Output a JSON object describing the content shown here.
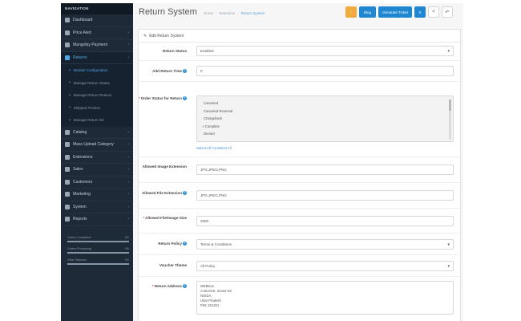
{
  "sidebar": {
    "header": "NAVIGATION",
    "items": [
      {
        "label": "Dashboard",
        "icon": "dashboard-icon",
        "chevron": false
      },
      {
        "label": "Price Alert",
        "icon": "tag-icon",
        "chevron": true
      },
      {
        "label": "Mangofay Payment",
        "icon": "card-icon",
        "chevron": true
      },
      {
        "label": "Returns",
        "icon": "return-icon",
        "chevron": true,
        "active": true
      }
    ],
    "subitems": [
      {
        "label": "Module Configuration",
        "current": true
      },
      {
        "label": "Manage Return Status"
      },
      {
        "label": "Manage Return Reason"
      },
      {
        "label": "Shipped Product"
      },
      {
        "label": "Manage Return list"
      }
    ],
    "items2": [
      {
        "label": "Catalog",
        "icon": "catalog-icon",
        "chevron": true
      },
      {
        "label": "Mass Upload Category",
        "icon": "upload-icon",
        "chevron": true
      },
      {
        "label": "Extensions",
        "icon": "puzzle-icon",
        "chevron": true
      },
      {
        "label": "Sales",
        "icon": "cart-icon",
        "chevron": true
      },
      {
        "label": "Customers",
        "icon": "user-icon",
        "chevron": true
      },
      {
        "label": "Marketing",
        "icon": "share-icon",
        "chevron": true
      },
      {
        "label": "System",
        "icon": "gear-icon",
        "chevron": true
      },
      {
        "label": "Reports",
        "icon": "chart-icon",
        "chevron": true
      }
    ],
    "stats": [
      {
        "label": "Orders Completed",
        "value": "0%",
        "fill": 1.0
      },
      {
        "label": "Orders Processing",
        "value": "0%",
        "fill": 1.0
      },
      {
        "label": "Other Statuses",
        "value": "0%",
        "fill": 1.0
      }
    ]
  },
  "header": {
    "title": "Return System",
    "breadcrumbs": [
      "Home",
      "Extension",
      "Return System"
    ],
    "buttons": {
      "flag": "!",
      "blog": "Blog",
      "generate": "Generate Ticket",
      "save": "S",
      "share": "<",
      "back": "↶"
    }
  },
  "panel": {
    "heading": "Edit Return System",
    "fields": {
      "return_status": {
        "label": "Return Status",
        "value": "Enabled"
      },
      "return_time": {
        "label": "Add Return Time",
        "value": "0"
      },
      "order_status": {
        "label": "Order Status for Return",
        "options": [
          "Canceled",
          "Canceled Reversal",
          "Chargeback",
          "Complete",
          "Denied"
        ],
        "selected": "Complete",
        "select_all": "Select All / Unselect All"
      },
      "image_ext": {
        "label": "Allowed Image Extension",
        "value": "JPG,JPEG,PNG"
      },
      "file_ext": {
        "label": "Allowed File Extension",
        "value": "JPG,JPEG,PNG"
      },
      "file_size": {
        "label": "Allowed File/Image Size",
        "value": "2000"
      },
      "return_policy": {
        "label": "Return Policy",
        "value": "Terms & Conditions"
      },
      "voucher_theme": {
        "label": "Voucher Theme",
        "value": "All Policy"
      },
      "return_address": {
        "label": "Return Address",
        "lines": [
          "WEBKUL",
          "A-BLOCK, Sector-63",
          "NOIDA,",
          "Uttar Pradesh",
          "PIN: 201301"
        ]
      }
    }
  }
}
